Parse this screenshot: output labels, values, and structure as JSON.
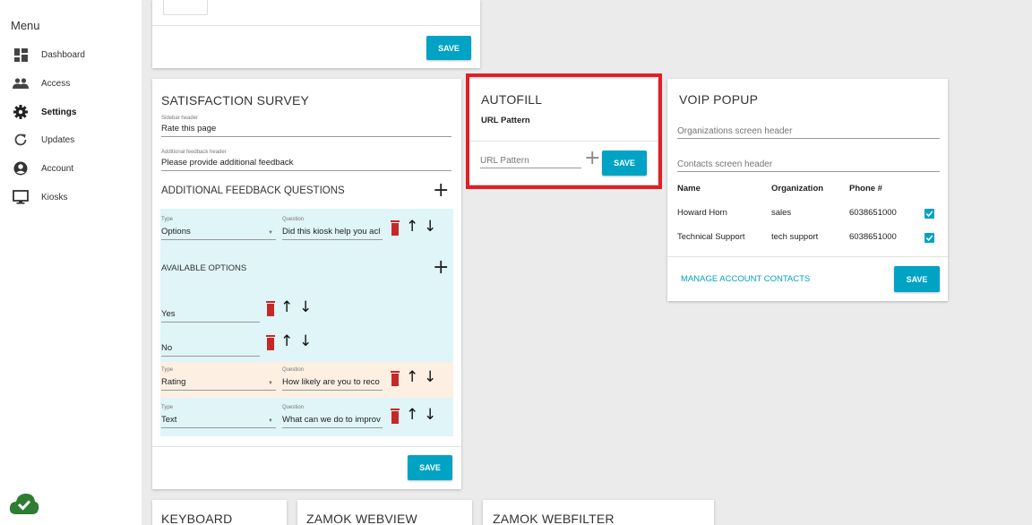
{
  "sidebar": {
    "title": "Menu",
    "items": [
      {
        "label": "Dashboard",
        "icon": "dashboard-icon",
        "active": false
      },
      {
        "label": "Access",
        "icon": "people-icon",
        "active": false
      },
      {
        "label": "Settings",
        "icon": "gear-icon",
        "active": true
      },
      {
        "label": "Updates",
        "icon": "refresh-icon",
        "active": false
      },
      {
        "label": "Account",
        "icon": "account-icon",
        "active": false
      },
      {
        "label": "Kiosks",
        "icon": "monitor-icon",
        "active": false
      }
    ]
  },
  "top_card": {
    "save_label": "SAVE"
  },
  "survey": {
    "title": "SATISFACTION SURVEY",
    "sidebar_header_label": "Sidebar header",
    "sidebar_header_value": "Rate this page",
    "additional_header_label": "Additional feedback header",
    "additional_header_value": "Please provide additional feedback",
    "questions_title": "ADDITIONAL FEEDBACK QUESTIONS",
    "type_label": "Type",
    "question_label": "Question",
    "questions": [
      {
        "type": "Options",
        "question": "Did this kiosk help you acl"
      },
      {
        "type": "Rating",
        "question": "How likely are you to reco"
      },
      {
        "type": "Text",
        "question": "What can we do to improv"
      }
    ],
    "available_options_title": "AVAILABLE OPTIONS",
    "options": [
      "Yes",
      "No"
    ],
    "save_label": "SAVE"
  },
  "autofill": {
    "title": "AUTOFILL",
    "subtitle": "URL Pattern",
    "input_placeholder": "URL Pattern",
    "save_label": "SAVE",
    "highlight_color": "#e31e24"
  },
  "voip": {
    "title": "VOIP POPUP",
    "org_header_placeholder": "Organizations screen header",
    "contacts_header_placeholder": "Contacts screen header",
    "columns": [
      "Name",
      "Organization",
      "Phone #"
    ],
    "rows": [
      {
        "name": "Howard Horn",
        "organization": "sales",
        "phone": "6038651000",
        "checked": true
      },
      {
        "name": "Technical Support",
        "organization": "tech support",
        "phone": "6038651000",
        "checked": true
      }
    ],
    "manage_link": "MANAGE ACCOUNT CONTACTS",
    "save_label": "SAVE"
  },
  "bottom_cards": {
    "keyboard_title": "KEYBOARD",
    "webview_title": "ZAMOK WEBVIEW",
    "webfilter_title": "ZAMOK WEBFILTER"
  },
  "colors": {
    "accent": "#00a3c4",
    "trash": "#c62828",
    "cloud": "#2e7d32"
  }
}
